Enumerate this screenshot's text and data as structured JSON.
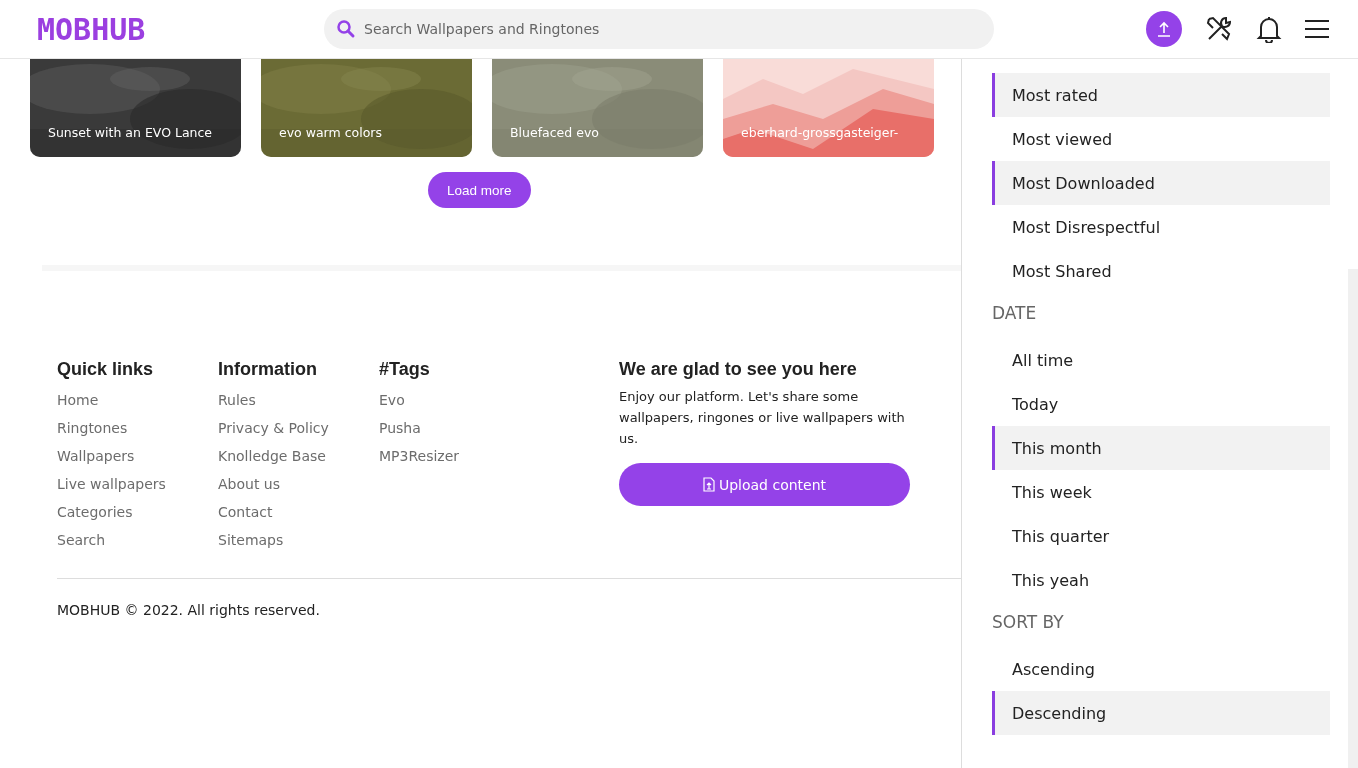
{
  "header": {
    "logo": "MOBHUB",
    "search": {
      "placeholder": "Search Wallpapers and Ringtones"
    }
  },
  "cards": [
    {
      "title": "Sunset with an EVO Lance"
    },
    {
      "title": "evo warm colors"
    },
    {
      "title": "Bluefaced evo"
    },
    {
      "title": "eberhard-grossgasteiger-"
    }
  ],
  "load_more": "Load more",
  "footer": {
    "columns": [
      {
        "heading": "Quick links",
        "links": [
          "Home",
          "Ringtones",
          "Wallpapers",
          "Live wallpapers",
          "Categories",
          "Search"
        ]
      },
      {
        "heading": "Information",
        "links": [
          "Rules",
          "Privacy & Policy",
          "Knolledge Base",
          "About us",
          "Contact",
          "Sitemaps"
        ]
      },
      {
        "heading": "#Tags",
        "links": [
          "Evo",
          "Pusha",
          "MP3Resizer"
        ]
      }
    ],
    "welcome": {
      "heading": "We are glad to see you here",
      "text": "Enjoy our platform. Let's share some wallpapers, ringones or live wallpapers with us.",
      "button": "Upload content"
    },
    "copyright": "MOBHUB © 2022. All rights reserved."
  },
  "filter_panel": {
    "groups": [
      {
        "items": [
          {
            "label": "Most rated",
            "selected": true
          },
          {
            "label": "Most viewed",
            "selected": false
          },
          {
            "label": "Most Downloaded",
            "selected": true
          },
          {
            "label": "Most Disrespectful",
            "selected": false
          },
          {
            "label": "Most Shared",
            "selected": false
          }
        ]
      },
      {
        "heading": "DATE",
        "items": [
          {
            "label": "All time",
            "selected": false
          },
          {
            "label": "Today",
            "selected": false
          },
          {
            "label": "This month",
            "selected": true
          },
          {
            "label": "This week",
            "selected": false
          },
          {
            "label": "This quarter",
            "selected": false
          },
          {
            "label": "This yeah",
            "selected": false
          }
        ]
      },
      {
        "heading": "SORT BY",
        "items": [
          {
            "label": "Ascending",
            "selected": false
          },
          {
            "label": "Descending",
            "selected": true
          }
        ]
      }
    ]
  }
}
